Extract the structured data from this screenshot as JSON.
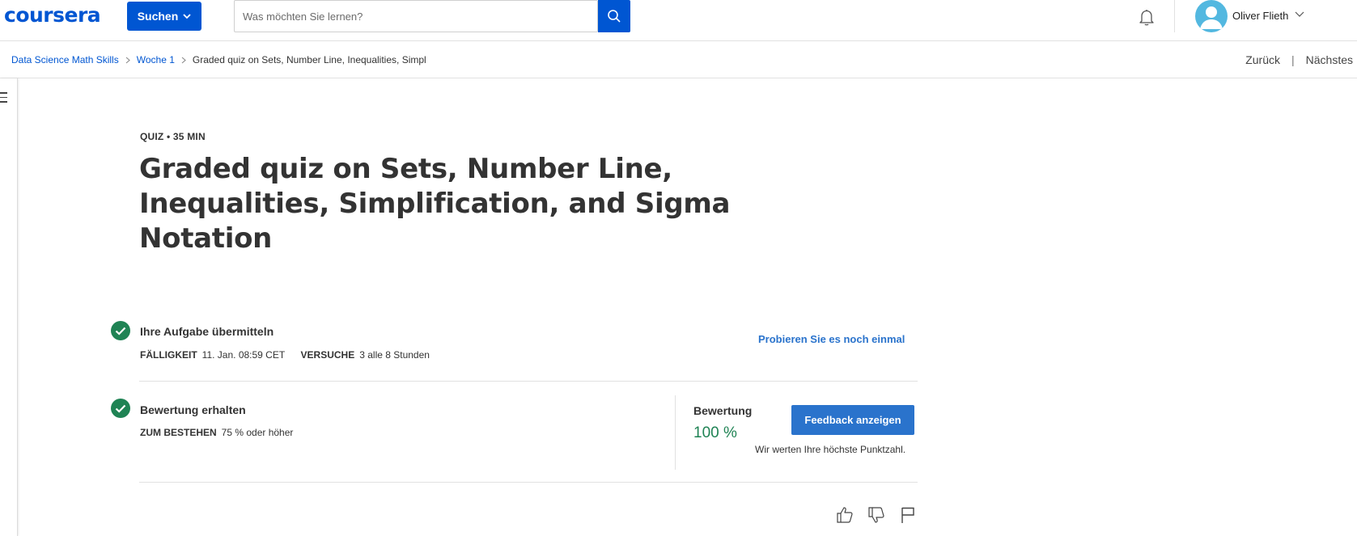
{
  "header": {
    "logo": "coursera",
    "search_button_label": "Suchen",
    "search_placeholder": "Was möchten Sie lernen?",
    "user_name": "Oliver Flieth",
    "brand_color": "#0056d2"
  },
  "breadcrumb": {
    "items": [
      "Data Science Math Skills",
      "Woche 1"
    ],
    "current": "Graded quiz on Sets, Number Line, Inequalities, Simpl",
    "back_label": "Zurück",
    "divider": "|",
    "next_label": "Nächstes"
  },
  "quiz": {
    "meta": "QUIZ • 35 MIN",
    "title": "Graded quiz on Sets, Number Line, Inequalities, Simplification, and Sigma Notation"
  },
  "submit_step": {
    "title": "Ihre Aufgabe übermitteln",
    "due_label": "FÄLLIGKEIT",
    "due_value": "11. Jan. 08:59 CET",
    "attempts_label": "VERSUCHE",
    "attempts_value": "3 alle 8 Stunden",
    "retry_link": "Probieren Sie es noch einmal"
  },
  "grade_step": {
    "title": "Bewertung erhalten",
    "pass_label": "ZUM BESTEHEN",
    "pass_value": "75 % oder höher",
    "grade_label": "Bewertung",
    "grade_value": "100 %",
    "feedback_button": "Feedback anzeigen",
    "highest_note": "Wir werten Ihre höchste Punktzahl.",
    "success_color": "#1f8354"
  },
  "feedback_icons": [
    "thumbs-up-icon",
    "thumbs-down-icon",
    "flag-icon"
  ]
}
